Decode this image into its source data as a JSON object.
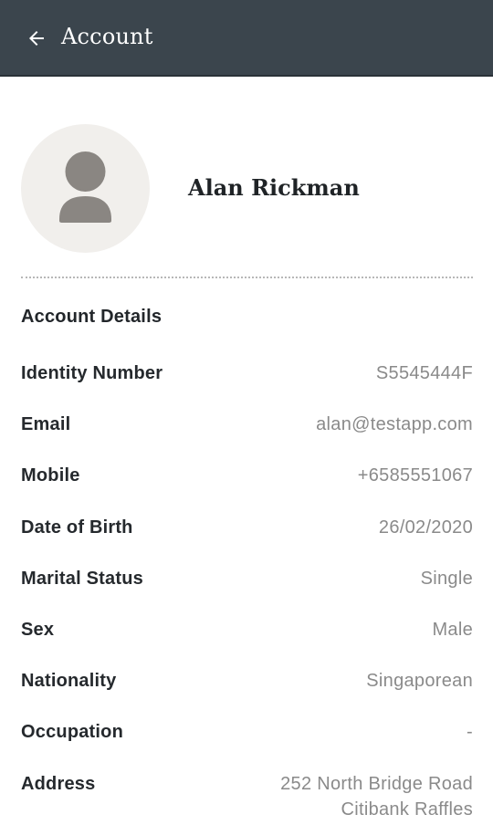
{
  "appbar": {
    "title": "Account",
    "background": "#3b454d",
    "back_icon": "arrow-left-icon"
  },
  "profile": {
    "name": "Alan Rickman",
    "avatar_icon": "user-silhouette-icon"
  },
  "section": {
    "title": "Account Details"
  },
  "details": [
    {
      "label": "Identity Number",
      "value": "S5545444F"
    },
    {
      "label": "Email",
      "value": "alan@testapp.com"
    },
    {
      "label": "Mobile",
      "value": "+6585551067"
    },
    {
      "label": "Date of Birth",
      "value": "26/02/2020"
    },
    {
      "label": "Marital Status",
      "value": "Single"
    },
    {
      "label": "Sex",
      "value": "Male"
    },
    {
      "label": "Nationality",
      "value": "Singaporean"
    },
    {
      "label": "Occupation",
      "value": "-"
    },
    {
      "label": "Address",
      "value": "252 North Bridge Road Citibank Raffles"
    }
  ]
}
